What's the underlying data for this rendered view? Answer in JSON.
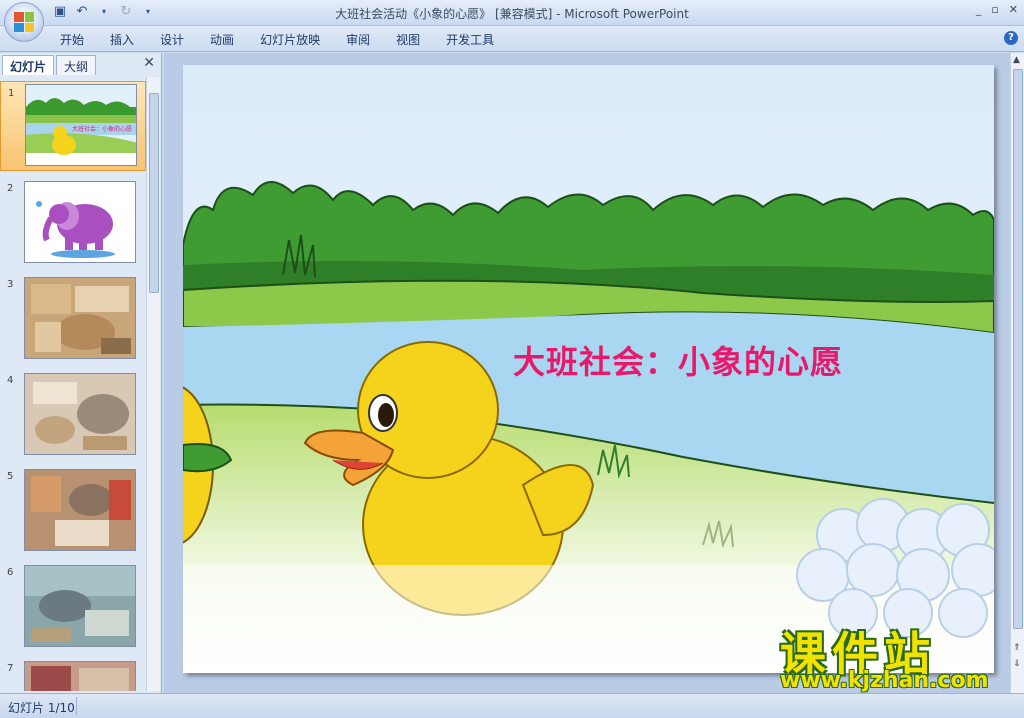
{
  "window": {
    "title": "大班社会活动《小象的心愿》 [兼容模式] - Microsoft PowerPoint",
    "controls": [
      "_",
      "▫",
      "✕"
    ]
  },
  "ribbon": {
    "tabs": [
      "开始",
      "插入",
      "设计",
      "动画",
      "幻灯片放映",
      "审阅",
      "视图",
      "开发工具"
    ]
  },
  "panel": {
    "tabs": [
      "幻灯片",
      "大纲"
    ],
    "active_tab": "幻灯片",
    "close_glyph": "✕",
    "slides": [
      {
        "num": "1",
        "selected": true
      },
      {
        "num": "2",
        "selected": false
      },
      {
        "num": "3",
        "selected": false
      },
      {
        "num": "4",
        "selected": false
      },
      {
        "num": "5",
        "selected": false
      },
      {
        "num": "6",
        "selected": false
      },
      {
        "num": "7",
        "selected": false
      }
    ]
  },
  "slide": {
    "title": "大班社会：小象的心愿"
  },
  "watermark": {
    "logo": "课件站",
    "url": "www.kjzhan.com"
  },
  "status": {
    "slide_indicator": "幻灯片 1/10"
  },
  "colors": {
    "title": "#e8196b",
    "selection": "#f8c472"
  }
}
